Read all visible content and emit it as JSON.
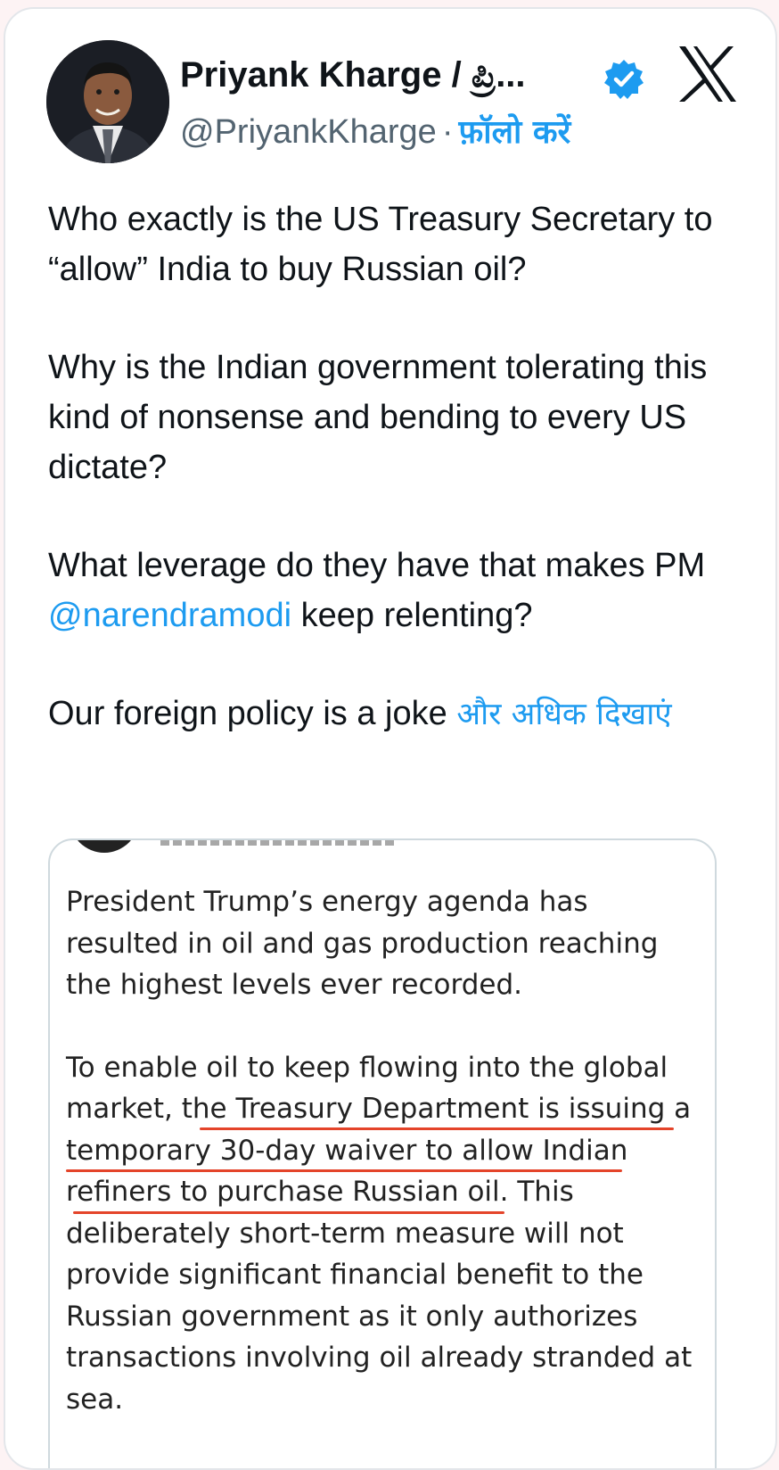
{
  "author": {
    "name": "Priyank Kharge / ಪ್ರಿ...",
    "handle": "@PriyankKharge",
    "separator": "·",
    "follow_label": "फ़ॉलो करें",
    "verified": true,
    "avatar_icon": "profile-photo"
  },
  "platform_logo": "x-logo-icon",
  "tweet": {
    "paragraph_1": "Who exactly is the US Treasury Secretary to “allow” India to buy Russian oil?",
    "paragraph_2": "Why is the Indian government tolerating this kind of nonsense and bending to every US dictate?",
    "paragraph_3_before": "What leverage do they have that makes PM ",
    "paragraph_3_mention": "@narendramodi",
    "paragraph_3_after": " keep relenting?",
    "paragraph_4": "Our foreign policy is a joke ",
    "show_more": "और अधिक दिखाएं"
  },
  "quoted_post": {
    "paragraph_1": "President Trump’s energy agenda has resulted in oil and gas production reaching the highest levels ever recorded.",
    "paragraph_2": "To enable oil to keep flowing into the global market, the Treasury Department is issuing a temporary 30-day waiver to allow Indian refiners to purchase Russian oil. This deliberately short-term measure will not provide significant financial benefit to the Russian government as it only authorizes transactions involving oil already stranded at sea.",
    "highlight_color": "#e4442a"
  },
  "colors": {
    "link": "#1d9bf0",
    "text": "#0f1419",
    "secondary": "#536471"
  }
}
